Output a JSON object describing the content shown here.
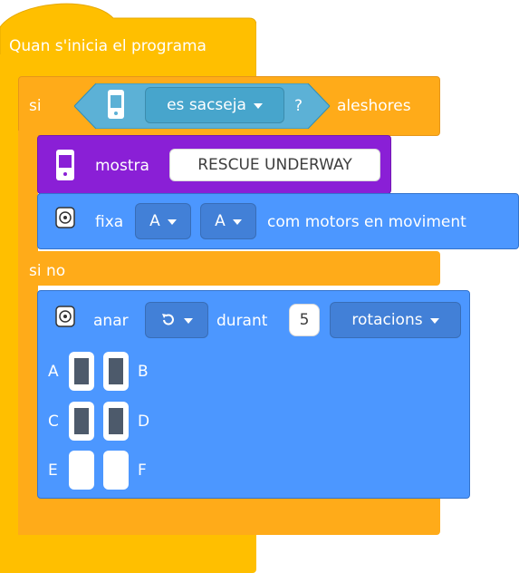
{
  "hat": {
    "label": "Quan s'inicia el programa"
  },
  "if_block": {
    "if_label": "si",
    "condition_dropdown": "es sacseja",
    "condition_mark": "?",
    "then_label": "aleshores",
    "else_label": "si no"
  },
  "display_block": {
    "label": "mostra",
    "text_value": "RESCUE UNDERWAY"
  },
  "motor_set_block": {
    "label": "fixa",
    "port1": "A",
    "port2": "A",
    "suffix": "com motors en moviment"
  },
  "motor_run_block": {
    "label": "anar",
    "direction_icon": "rotate-ccw-icon",
    "during_label": "durant",
    "amount": "5",
    "unit": "rotacions",
    "ports": [
      {
        "left": "A",
        "right": "B"
      },
      {
        "left": "C",
        "right": "D"
      },
      {
        "left": "E",
        "right": "F"
      }
    ]
  },
  "colors": {
    "events_yellow": "#FFBF00",
    "control_orange": "#FFAB19",
    "looks_purple": "#9966FF",
    "display_purple": "#8A1FD6",
    "motor_blue": "#4C97FF",
    "sensor_cyan": "#5CB1D6"
  }
}
